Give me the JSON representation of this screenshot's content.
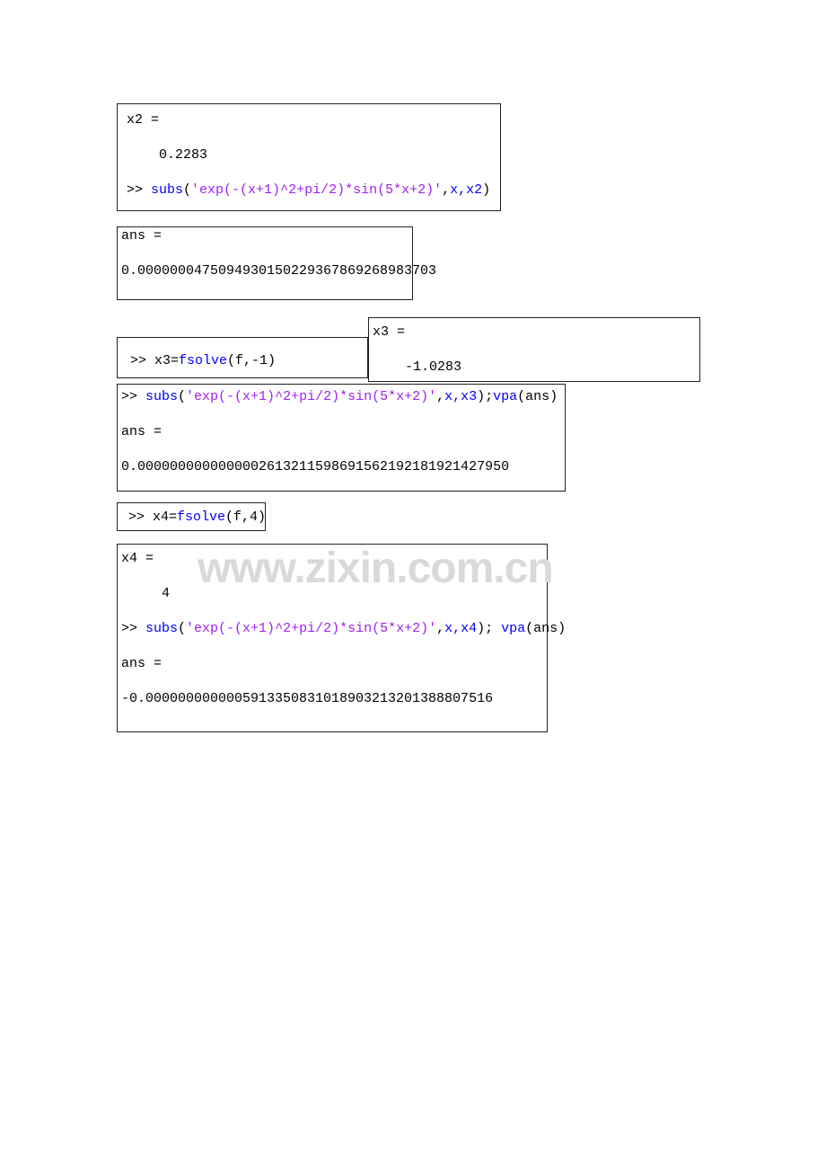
{
  "colors": {
    "prompt": "#000000",
    "keyword": "#0000ff",
    "string": "#a020f0",
    "border": "#222222",
    "watermark": "#d9d9d9"
  },
  "watermark": "www.zixin.com.cn",
  "box1": {
    "l1": "x2 =",
    "l2": "    0.2283",
    "prompt": ">> ",
    "fn1": "subs",
    "p1": "(",
    "str1": "'exp(-(x+1)^2+pi/2)*sin(5*x+2)'",
    "p2": ",",
    "a1": "x,x2",
    "p3": ")"
  },
  "box2": {
    "l1": "ans =",
    "l2": "0.0000000475094930150229367869268983703"
  },
  "box3": {
    "prompt": ">> ",
    "a1": "x3=",
    "fn1": "fsolve",
    "p1": "(f,-1)"
  },
  "box4": {
    "l1": "x3 =",
    "l2": "    -1.0283"
  },
  "box5": {
    "prompt1": ">> ",
    "fn1": "subs",
    "p1": "(",
    "str1": "'exp(-(x+1)^2+pi/2)*sin(5*x+2)'",
    "p2": ",",
    "a1": "x,x3",
    "p3": ");",
    "fn2": "vpa",
    "p4": "(ans)",
    "l2": "ans =",
    "l3": "0.0000000000000002613211598691562192181921427950"
  },
  "box6": {
    "prompt": ">> ",
    "a1": "x4=",
    "fn1": "fsolve",
    "p2": "(f,4)"
  },
  "box7": {
    "l1": "x4 =",
    "l2": "     4",
    "prompt": ">> ",
    "fn1": "subs",
    "p1": "(",
    "str1": "'exp(-(x+1)^2+pi/2)*sin(5*x+2)'",
    "p2": ",",
    "a1": "x,x4",
    "p3": "); ",
    "fn2": "vpa",
    "p4": "(ans)",
    "l4": "ans =",
    "l5": "-0.0000000000005913350831018903213201388807516"
  }
}
